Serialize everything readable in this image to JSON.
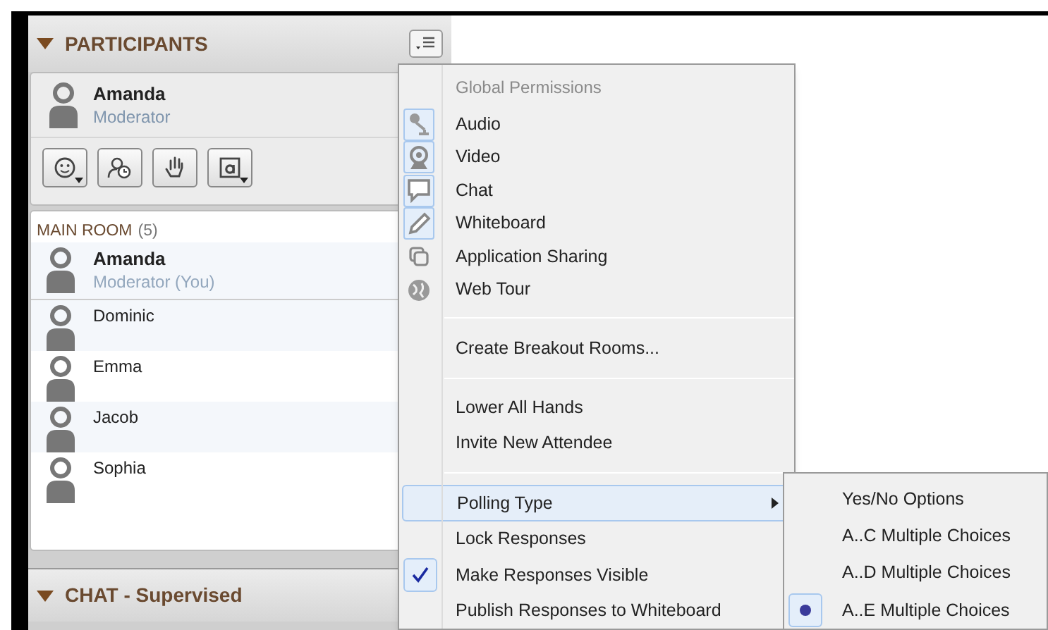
{
  "participants_panel": {
    "title": "PARTICIPANTS",
    "expanded": true,
    "current_user": {
      "name": "Amanda",
      "role": "Moderator"
    },
    "room": {
      "label": "MAIN ROOM",
      "count": "(5)"
    },
    "attendees": [
      {
        "name": "Amanda",
        "role": "Moderator (You)"
      },
      {
        "name": "Dominic"
      },
      {
        "name": "Emma"
      },
      {
        "name": "Jacob"
      },
      {
        "name": "Sophia"
      }
    ]
  },
  "chat_panel": {
    "title": "CHAT - Supervised",
    "expanded": true
  },
  "menu": {
    "items": [
      {
        "kind": "header",
        "label": "Global Permissions"
      },
      {
        "kind": "permission",
        "label": "Audio",
        "on": true
      },
      {
        "kind": "permission",
        "label": "Video",
        "on": true
      },
      {
        "kind": "permission",
        "label": "Chat",
        "on": true
      },
      {
        "kind": "permission",
        "label": "Whiteboard",
        "on": true
      },
      {
        "kind": "permission",
        "label": "Application Sharing",
        "on": false
      },
      {
        "kind": "permission",
        "label": "Web Tour",
        "on": false
      },
      {
        "kind": "separator"
      },
      {
        "kind": "action",
        "label": "Create Breakout Rooms..."
      },
      {
        "kind": "separator"
      },
      {
        "kind": "action",
        "label": "Lower All Hands"
      },
      {
        "kind": "action",
        "label": "Invite New Attendee"
      },
      {
        "kind": "separator"
      },
      {
        "kind": "submenu",
        "label": "Polling Type",
        "selected": true
      },
      {
        "kind": "check",
        "label": "Lock Responses",
        "checked": false
      },
      {
        "kind": "check",
        "label": "Make Responses Visible",
        "checked": true
      },
      {
        "kind": "check",
        "label": "Publish Responses to Whiteboard",
        "checked": false
      }
    ]
  },
  "submenu": {
    "items": [
      {
        "label": "Yes/No Options",
        "selected": false
      },
      {
        "label": "A..C Multiple Choices",
        "selected": false
      },
      {
        "label": "A..D Multiple Choices",
        "selected": false
      },
      {
        "label": "A..E Multiple Choices",
        "selected": true
      }
    ]
  }
}
